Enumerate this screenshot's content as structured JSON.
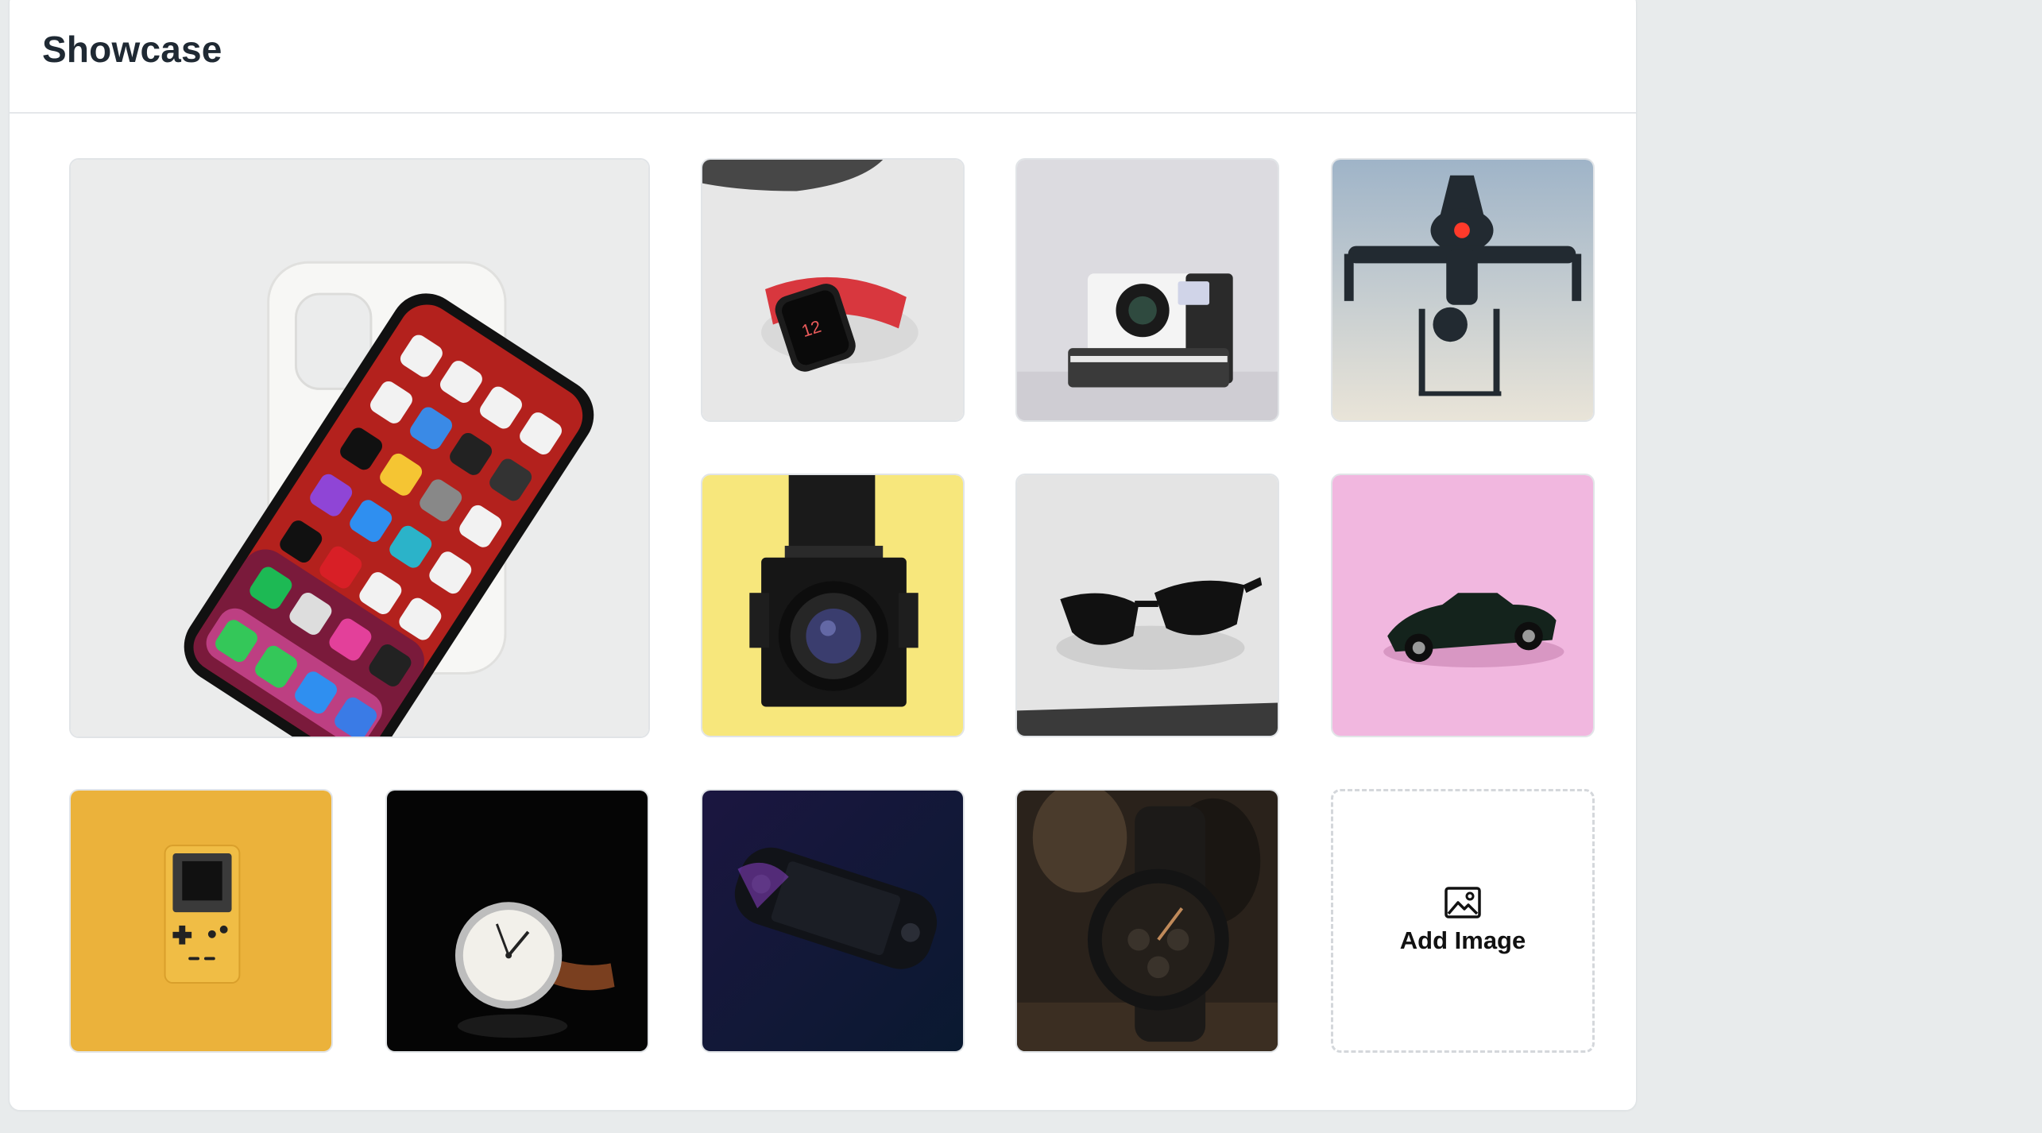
{
  "header": {
    "title": "Showcase"
  },
  "gallery": {
    "add_label": "Add Image",
    "items": [
      {
        "name": "smartphone-photo",
        "bg": "#eaebec"
      },
      {
        "name": "smartwatch-photo",
        "bg": "#e6e6e6"
      },
      {
        "name": "instant-camera-photo",
        "bg": "#d9d8dd"
      },
      {
        "name": "drone-photo",
        "bg": "#b8c8d6"
      },
      {
        "name": "medium-format-camera-photo",
        "bg": "#f6e47a"
      },
      {
        "name": "sunglasses-photo",
        "bg": "#e6e6e6"
      },
      {
        "name": "toy-car-photo",
        "bg": "#f0b5dd"
      },
      {
        "name": "handheld-console-photo",
        "bg": "#eab23a"
      },
      {
        "name": "wristwatch-photo",
        "bg": "#050505"
      },
      {
        "name": "portable-gaming-pc-photo",
        "bg": "#0e1a33"
      },
      {
        "name": "chronograph-watch-photo",
        "bg": "#2b231c"
      }
    ]
  }
}
